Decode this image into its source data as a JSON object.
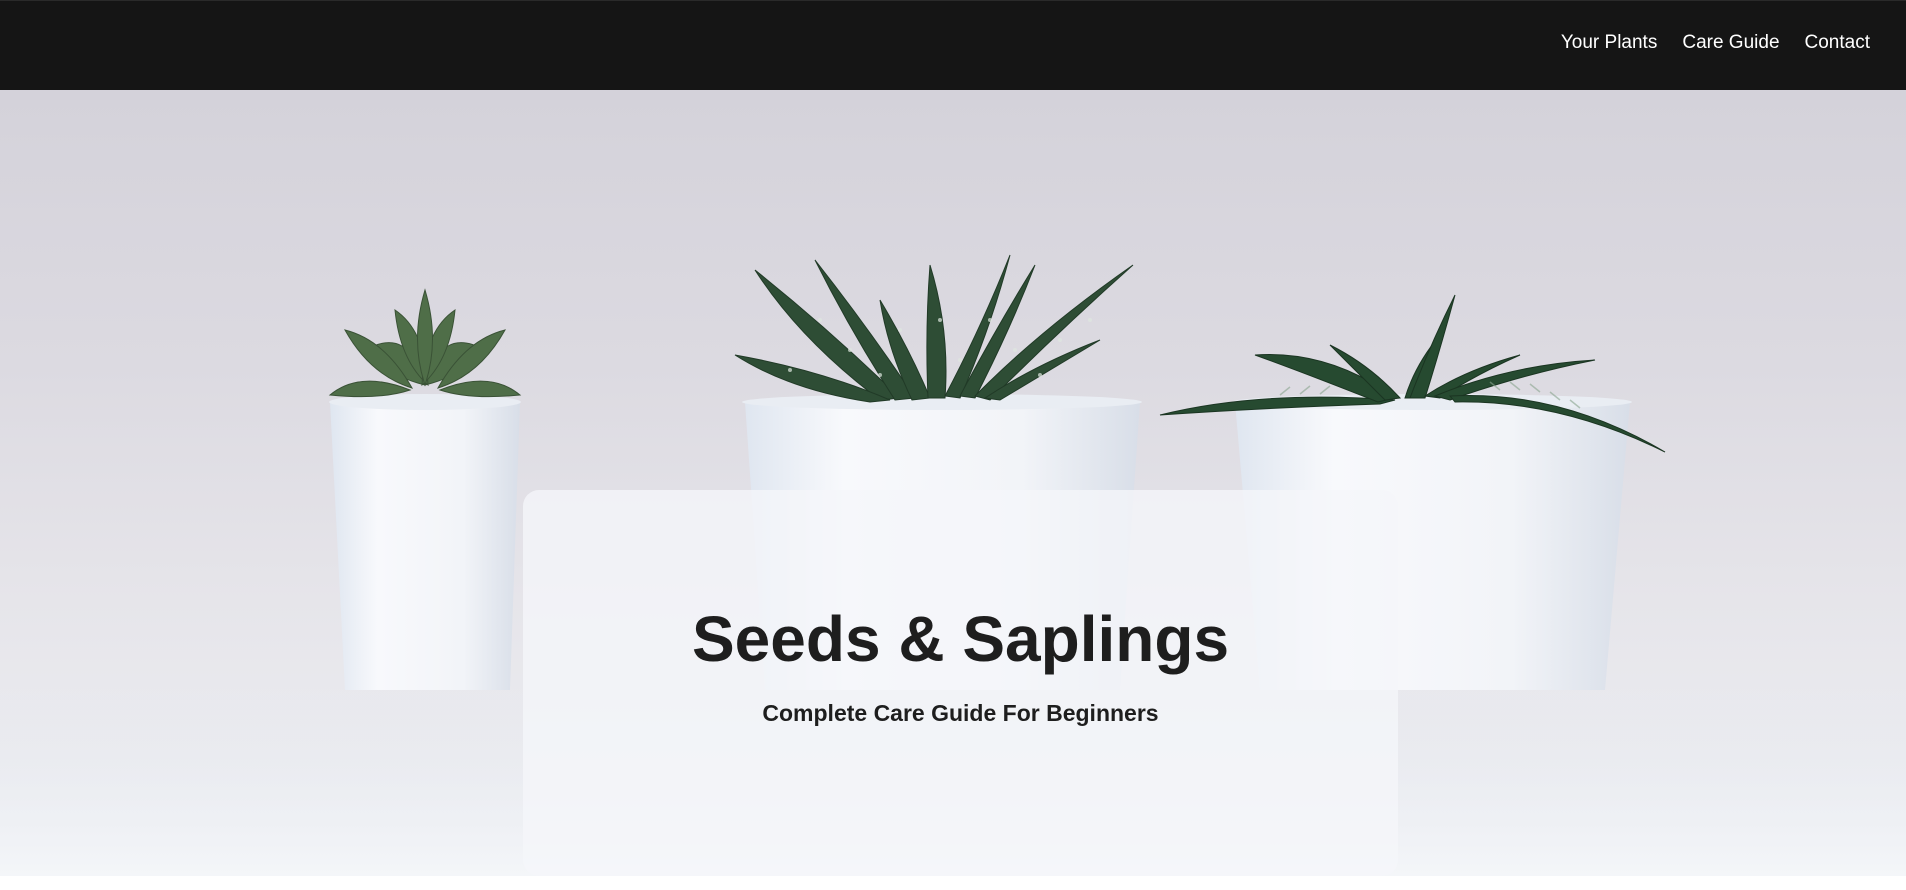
{
  "nav": {
    "items": [
      {
        "label": "Your Plants"
      },
      {
        "label": "Care Guide"
      },
      {
        "label": "Contact"
      }
    ]
  },
  "hero": {
    "image_subject": "three succulents in white pots",
    "title": "Seeds & Saplings",
    "subtitle": "Complete Care Guide For Beginners"
  },
  "colors": {
    "nav_background": "#151515",
    "nav_text": "#ffffff",
    "heading_text": "#1e1e1e",
    "pot_white": "#f3f5f9",
    "leaf_green": "#2f5a3a"
  }
}
